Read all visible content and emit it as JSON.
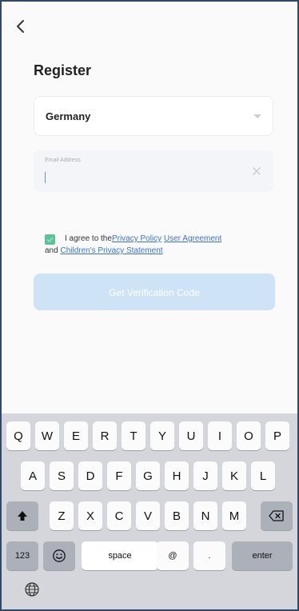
{
  "header": {
    "back_icon": "chevron-left-icon"
  },
  "page": {
    "title": "Register"
  },
  "country": {
    "value": "Germany",
    "caret_icon": "caret-down-icon"
  },
  "email": {
    "label": "Email Address",
    "value": "",
    "clear_icon": "clear-x-icon"
  },
  "agreement": {
    "checked": true,
    "prefix": "I agree to the",
    "privacy_policy": "Privacy Policy",
    "user_agreement": "User Agreement",
    "and": "and",
    "children_privacy": "Children's Privacy Statement"
  },
  "verify_button": {
    "label": "Get Verification Code"
  },
  "keyboard": {
    "row1": [
      "Q",
      "W",
      "E",
      "R",
      "T",
      "Y",
      "U",
      "I",
      "O",
      "P"
    ],
    "row2": [
      "A",
      "S",
      "D",
      "F",
      "G",
      "H",
      "J",
      "K",
      "L"
    ],
    "row3": [
      "Z",
      "X",
      "C",
      "V",
      "B",
      "N",
      "M"
    ],
    "numbers_label": "123",
    "space_label": "space",
    "at_label": "@",
    "dot_label": ".",
    "enter_label": "enter",
    "icons": [
      "shift-icon",
      "backspace-icon",
      "emoji-icon",
      "globe-icon"
    ]
  }
}
